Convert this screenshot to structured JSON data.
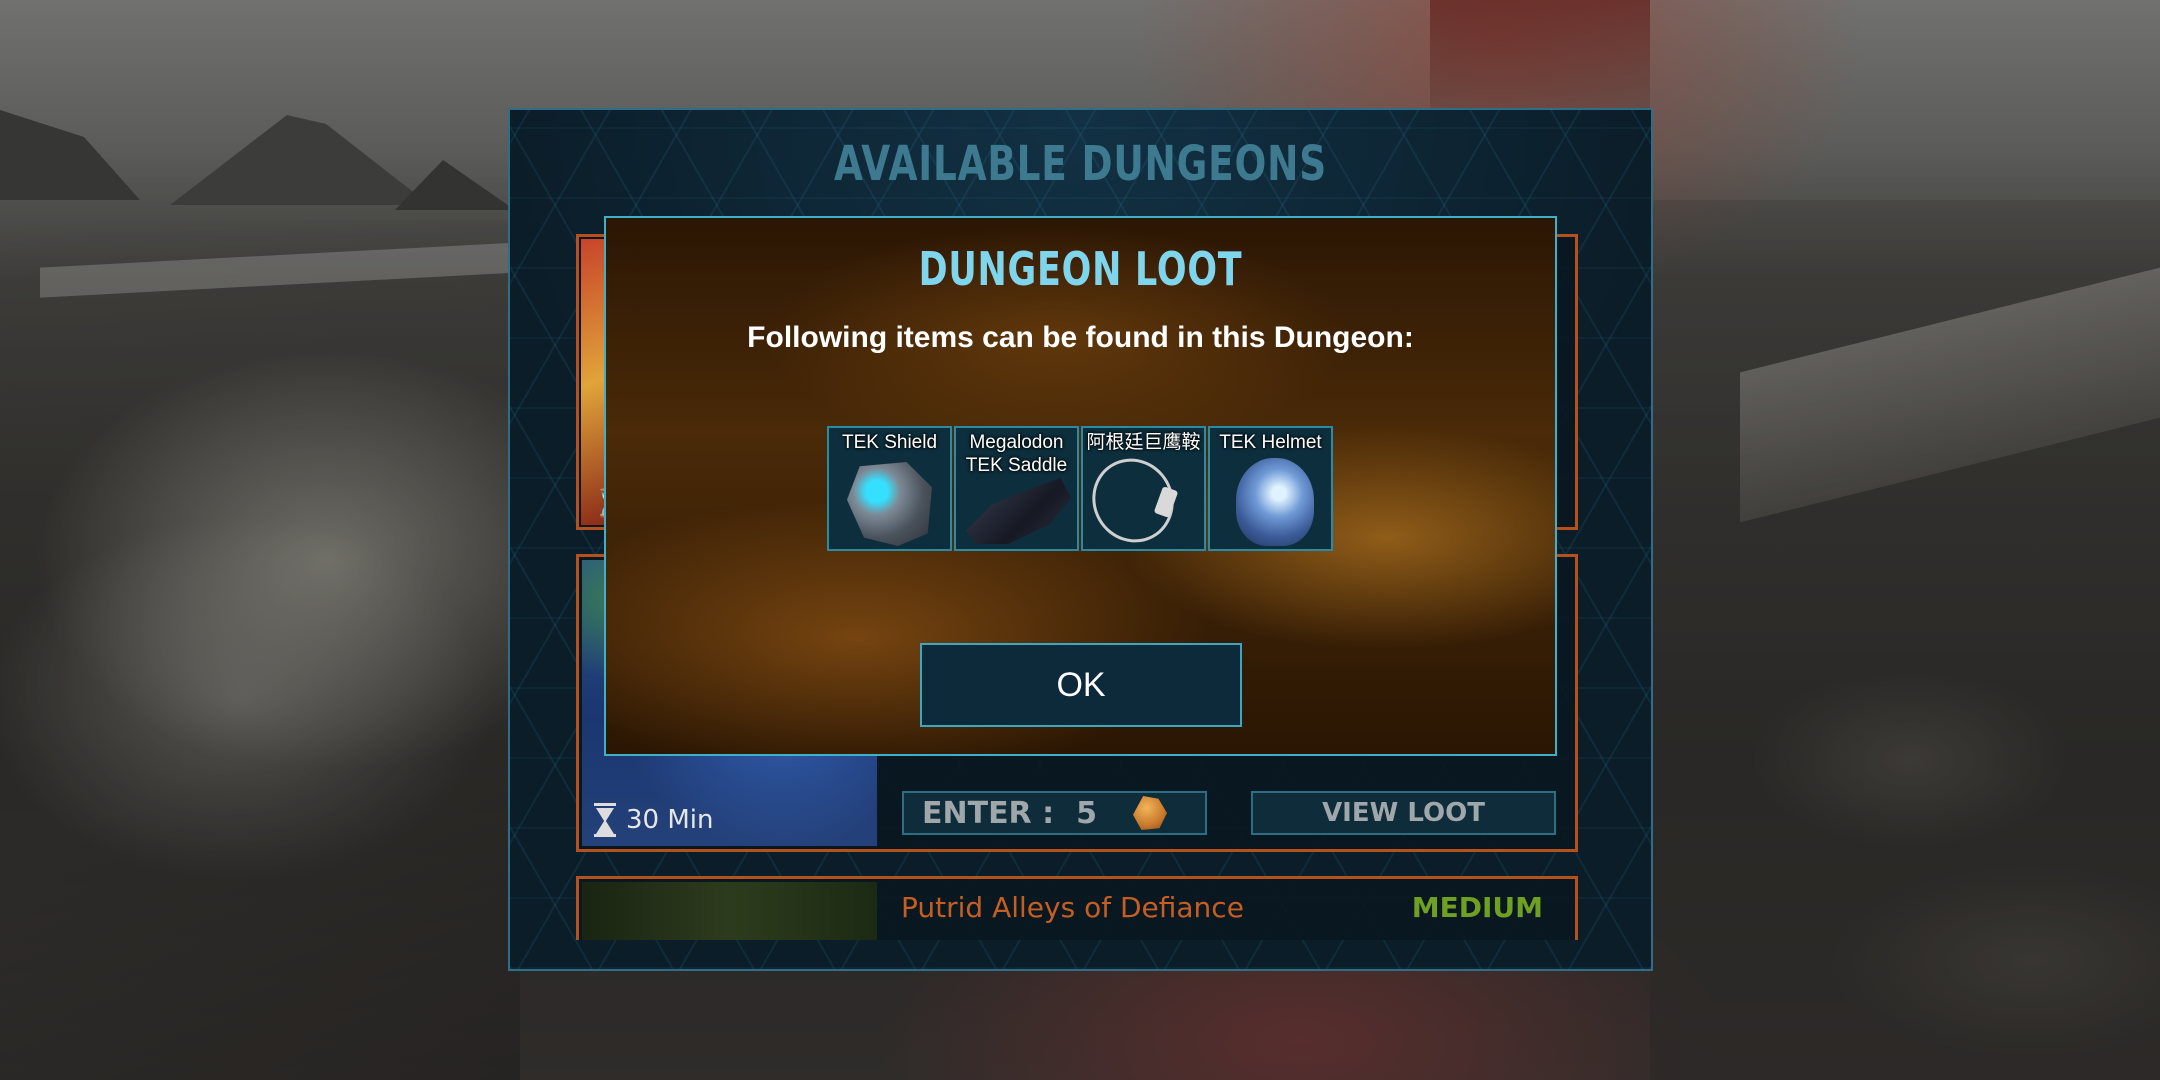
{
  "dungeon_list": {
    "title": "AVAILABLE DUNGEONS",
    "featured_card": {
      "timer": "30 Min",
      "enter_label": "ENTER :",
      "enter_cost": "5",
      "view_loot_label": "VIEW LOOT"
    },
    "next_card": {
      "name": "Putrid Alleys of Defiance",
      "difficulty": "MEDIUM"
    }
  },
  "loot_modal": {
    "title": "DUNGEON LOOT",
    "subtitle": "Following items can be found in this Dungeon:",
    "items": [
      {
        "name": "TEK Shield",
        "icon": "tek-shield-icon"
      },
      {
        "name": "Megalodon TEK Saddle",
        "icon": "megalodon-saddle-icon"
      },
      {
        "name": "阿根廷巨鹰鞍",
        "icon": "necklace-icon"
      },
      {
        "name": "TEK Helmet",
        "icon": "tek-helmet-icon"
      }
    ],
    "ok_label": "OK"
  },
  "colors": {
    "panel_border": "#2f6e86",
    "card_border": "#b4511d",
    "modal_border": "#3fb0c8",
    "modal_title": "#7fd6ec",
    "difficulty_medium": "#6fa022",
    "dungeon_name": "#c65e22"
  }
}
